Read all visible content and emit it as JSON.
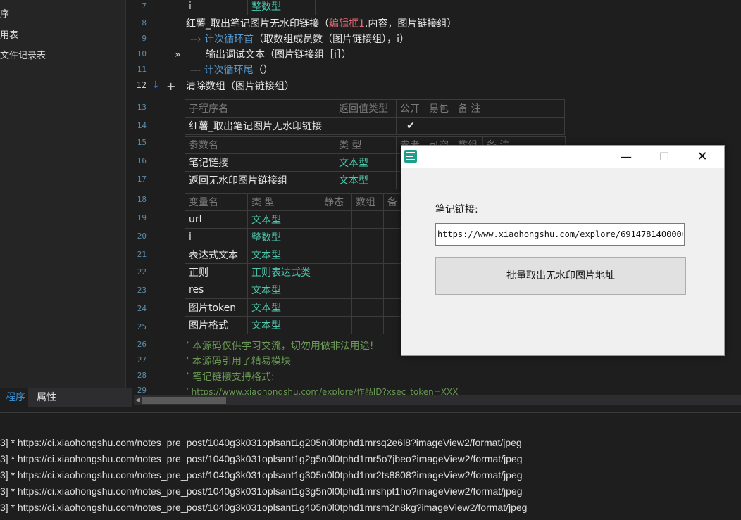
{
  "left_panel": {
    "items": [
      "序",
      "用表",
      "文件记录表"
    ],
    "tabs": [
      {
        "label": "程序"
      },
      {
        "label": "属性"
      }
    ]
  },
  "line_numbers": [
    "7",
    "8",
    "9",
    "10",
    "11",
    "12",
    "13",
    "14",
    "15",
    "16",
    "17",
    "18",
    "19",
    "20",
    "21",
    "22",
    "23",
    "24",
    "25",
    "26",
    "27",
    "28",
    "29"
  ],
  "code": {
    "line7_name": "i",
    "line7_type": "整数型",
    "line8_a": "红薯_取出笔记图片无水印链接（",
    "line8_b": "编辑框1",
    "line8_c": ".内容，图片链接组）",
    "line9_a": "计次循环首",
    "line9_b": "（取数组成员数（图片链接组），i）",
    "line10": "输出调试文本（图片链接组［i］）",
    "line11_a": "计次循环尾",
    "line11_b": "（）",
    "line12_plus": "+",
    "line12": "清除数组（图片链接组）",
    "comment1": "’ 本源码仅供学习交流，切勿用做非法用途!",
    "comment2": "’ 本源码引用了精易模块",
    "comment3": "’ 笔记链接支持格式:",
    "comment4": "’ https://www.xiaohongshu.com/explore/作品ID?xsec_token=XXX"
  },
  "sub_table": {
    "headers": [
      "子程序名",
      "返回值类型",
      "公开",
      "易包",
      "备 注"
    ],
    "name": "红薯_取出笔记图片无水印链接",
    "public_check": "✔"
  },
  "param_table": {
    "headers": [
      "参数名",
      "类 型",
      "参考",
      "可空",
      "数组",
      "备 注"
    ],
    "rows": [
      {
        "name": "笔记链接",
        "type": "文本型"
      },
      {
        "name": "返回无水印图片链接组",
        "type": "文本型"
      }
    ]
  },
  "var_table": {
    "headers": [
      "变量名",
      "类 型",
      "静态",
      "数组",
      "备"
    ],
    "rows": [
      {
        "name": "url",
        "type": "文本型"
      },
      {
        "name": "i",
        "type": "整数型"
      },
      {
        "name": "表达式文本",
        "type": "文本型"
      },
      {
        "name": "正则",
        "type": "正则表达式类"
      },
      {
        "name": "res",
        "type": "文本型"
      },
      {
        "name": "图片token",
        "type": "文本型"
      },
      {
        "name": "图片格式",
        "type": "文本型"
      }
    ]
  },
  "output": {
    "lines": [
      "3] * https://ci.xiaohongshu.com/notes_pre_post/1040g3k031oplsant1g205n0l0tphd1mrsq2e6l8?imageView2/format/jpeg",
      "3] * https://ci.xiaohongshu.com/notes_pre_post/1040g3k031oplsant1g2g5n0l0tphd1mr5o7jbeo?imageView2/format/jpeg",
      "3] * https://ci.xiaohongshu.com/notes_pre_post/1040g3k031oplsant1g305n0l0tphd1mr2ts8808?imageView2/format/jpeg",
      "3] * https://ci.xiaohongshu.com/notes_pre_post/1040g3k031oplsant1g3g5n0l0tphd1mrshpt1ho?imageView2/format/jpeg",
      "3] * https://ci.xiaohongshu.com/notes_pre_post/1040g3k031oplsant1g405n0l0tphd1mrsm2n8kg?imageView2/format/jpeg"
    ]
  },
  "dialog": {
    "label": "笔记链接:",
    "input_value": "https://www.xiaohongshu.com/explore/6914781400000",
    "button_label": "批量取出无水印图片地址",
    "minimize": "—",
    "maximize": "☐",
    "close": "✕"
  },
  "icons": {
    "app_icon": "easy-language-app-icon",
    "debug_arrow": "»"
  },
  "colors": {
    "keyword_cyan": "#4ec9b0",
    "highlight_pink": "#e06c75",
    "comment_green": "#6a9955",
    "line_number": "#5a8aa8"
  }
}
